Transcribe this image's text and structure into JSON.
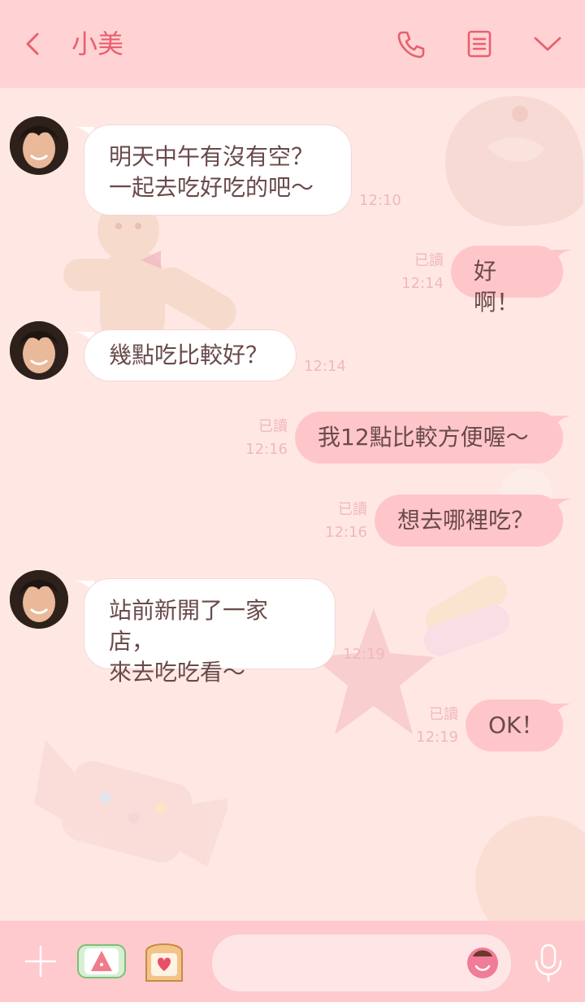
{
  "header": {
    "title": "小美",
    "icons": [
      "back-arrow-icon",
      "phone-icon",
      "notes-icon",
      "chevron-down-icon"
    ]
  },
  "messages": [
    {
      "side": "in",
      "text": [
        "明天中午有沒有空？",
        "一起去吃好吃的吧〜"
      ],
      "time": "12:10"
    },
    {
      "side": "out",
      "text": [
        "好啊！"
      ],
      "read": "已讀",
      "time": "12:14"
    },
    {
      "side": "in",
      "text": [
        "幾點吃比較好？"
      ],
      "time": "12:14"
    },
    {
      "side": "out",
      "text": [
        "我12點比較方便喔〜"
      ],
      "read": "已讀",
      "time": "12:16"
    },
    {
      "side": "out",
      "text": [
        "想去哪裡吃？"
      ],
      "read": "已讀",
      "time": "12:16"
    },
    {
      "side": "in",
      "text": [
        "站前新開了一家店，",
        "來去吃吃看〜"
      ],
      "time": "12:19"
    },
    {
      "side": "out",
      "text": [
        "OK！"
      ],
      "read": "已讀",
      "time": "12:19"
    }
  ],
  "input_bar": {
    "icons": [
      "plus-icon",
      "sticker-strawberry-icon",
      "sticker-toast-icon",
      "emoji-icon",
      "microphone-icon"
    ],
    "placeholder": ""
  },
  "colors": {
    "header_bg": "#FFD3D3",
    "accent": "#E8606F",
    "chat_bg": "#FFE8E3",
    "outgoing_bubble": "#FFC6CA",
    "incoming_bubble": "#FFFFFF",
    "input_bar_bg": "#FFCACD"
  }
}
